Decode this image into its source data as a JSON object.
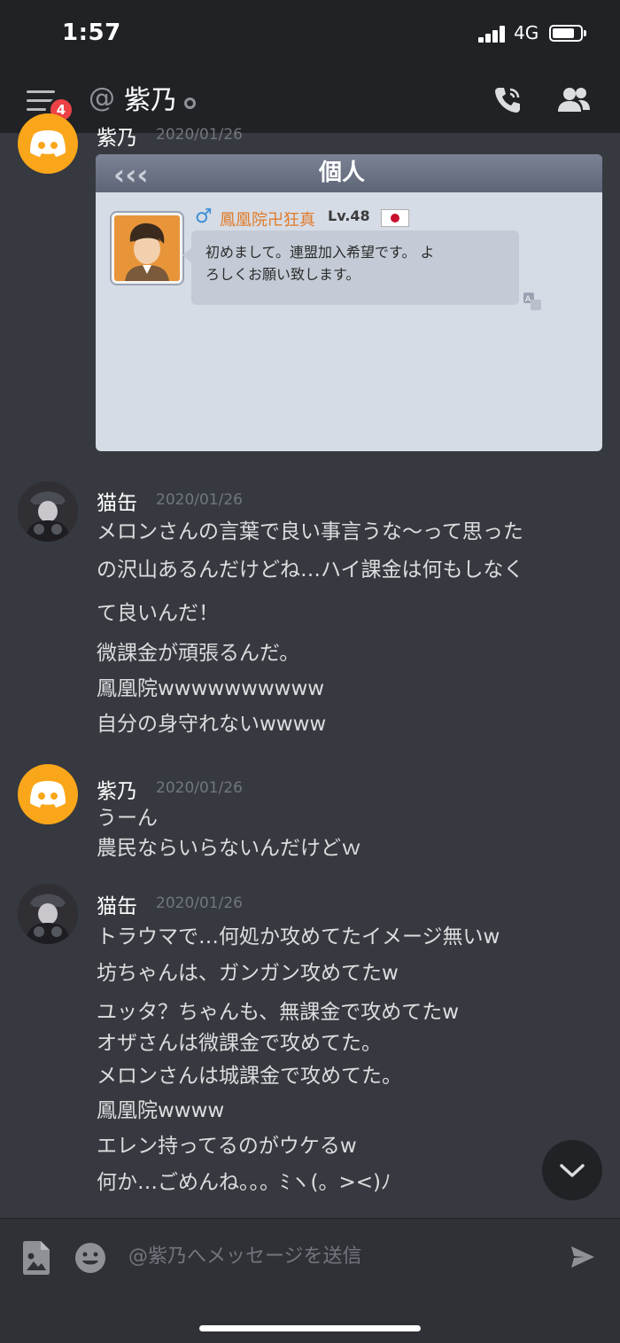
{
  "status_bar": {
    "time": "1:57",
    "network": "4G"
  },
  "header": {
    "menu_badge": "4",
    "at_symbol": "@",
    "channel_name": "紫乃"
  },
  "embed": {
    "title": "個人",
    "player_name": "鳳凰院卍狂真",
    "player_level": "Lv.48",
    "message_lines": [
      "初めまして。連盟加入希望です。 よ",
      "ろしくお願い致します。"
    ]
  },
  "messages": [
    {
      "author": "紫乃",
      "timestamp": "2020/01/26",
      "avatar": "discord-logo-icon"
    },
    {
      "author": "猫缶",
      "timestamp": "2020/01/26",
      "avatar": "user-photo-avatar",
      "lines": [
        "メロンさんの言葉で良い事言うな〜って思った",
        "の沢山あるんだけどね…ハイ課金は何もしなく",
        "て良いんだ！",
        "微課金が頑張るんだ。",
        "鳳凰院wwwwwwwwww",
        "自分の身守れないwwww"
      ]
    },
    {
      "author": "紫乃",
      "timestamp": "2020/01/26",
      "avatar": "discord-logo-icon",
      "lines": [
        "うーん",
        "農民ならいらないんだけどｗ"
      ]
    },
    {
      "author": "猫缶",
      "timestamp": "2020/01/26",
      "avatar": "user-photo-avatar",
      "lines": [
        "トラウマで…何処か攻めてたイメージ無いw",
        "坊ちゃんは、ガンガン攻めてたw",
        "ユッタ？ちゃんも、無課金で攻めてたw",
        "オザさんは微課金で攻めてた。",
        "メロンさんは城課金で攻めてた。",
        "鳳凰院wwww",
        "エレン持ってるのがウケるw",
        "何か…ごめんね。。。ﾐヽ(。><)ﾉ"
      ]
    }
  ],
  "composer": {
    "placeholder": "@紫乃へメッセージを送信"
  },
  "colors": {
    "background": "#36393f",
    "header": "#202225",
    "discord_avatar": "#faa61a",
    "badge": "#ed4245"
  }
}
